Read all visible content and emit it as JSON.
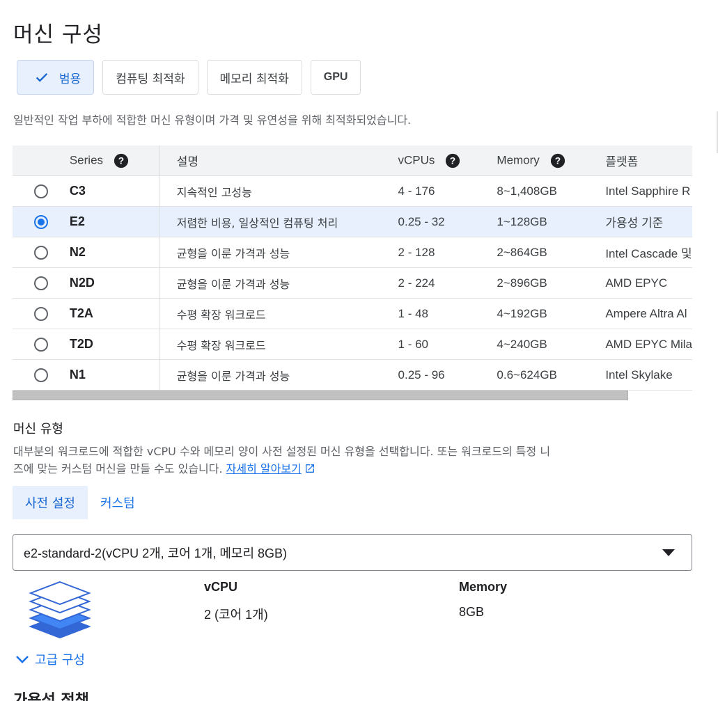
{
  "title": "머신 구성",
  "family_chips": [
    {
      "label": "범용",
      "selected": true
    },
    {
      "label": "컴퓨팅 최적화",
      "selected": false
    },
    {
      "label": "메모리 최적화",
      "selected": false
    },
    {
      "label": "GPU",
      "selected": false
    }
  ],
  "family_description": "일반적인 작업 부하에 적합한 머신 유형이며 가격 및 유연성을 위해 최적화되었습니다.",
  "series_table": {
    "headers": {
      "series": "Series",
      "description": "설명",
      "vcpus": "vCPUs",
      "memory": "Memory",
      "platform": "플랫폼"
    },
    "rows": [
      {
        "series": "C3",
        "description": "지속적인 고성능",
        "vcpus": "4 - 176",
        "memory": "8~1,408GB",
        "platform": "Intel Sapphire R",
        "selected": false
      },
      {
        "series": "E2",
        "description": "저렴한 비용, 일상적인 컴퓨팅 처리",
        "vcpus": "0.25 - 32",
        "memory": "1~128GB",
        "platform": "가용성 기준",
        "selected": true
      },
      {
        "series": "N2",
        "description": "균형을 이룬 가격과 성능",
        "vcpus": "2 - 128",
        "memory": "2~864GB",
        "platform": "Intel Cascade 및",
        "selected": false
      },
      {
        "series": "N2D",
        "description": "균형을 이룬 가격과 성능",
        "vcpus": "2 - 224",
        "memory": "2~896GB",
        "platform": "AMD EPYC",
        "selected": false
      },
      {
        "series": "T2A",
        "description": "수평 확장 워크로드",
        "vcpus": "1 - 48",
        "memory": "4~192GB",
        "platform": "Ampere Altra Al",
        "selected": false
      },
      {
        "series": "T2D",
        "description": "수평 확장 워크로드",
        "vcpus": "1 - 60",
        "memory": "4~240GB",
        "platform": "AMD EPYC Mila",
        "selected": false
      },
      {
        "series": "N1",
        "description": "균형을 이룬 가격과 성능",
        "vcpus": "0.25 - 96",
        "memory": "0.6~624GB",
        "platform": "Intel Skylake",
        "selected": false
      }
    ]
  },
  "machine_type": {
    "title": "머신 유형",
    "description": "대부분의 워크로드에 적합한 vCPU 수와 메모리 양이 사전 설정된 머신 유형을 선택합니다. 또는 워크로드의 특정 니즈에 맞는 커스텀 머신을 만들 수도 있습니다.",
    "learn_more": "자세히 알아보기",
    "tabs": [
      {
        "label": "사전 설정",
        "active": true
      },
      {
        "label": "커스텀",
        "active": false
      }
    ],
    "selected_value": "e2-standard-2(vCPU 2개, 코어 1개, 메모리 8GB)",
    "vcpu_label": "vCPU",
    "vcpu_value": "2 (코어 1개)",
    "memory_label": "Memory",
    "memory_value": "8GB"
  },
  "advanced_config": "고급 구성",
  "next_section_title": "가용성 정책",
  "colors": {
    "accent": "#1a73e8",
    "selected_bg": "#e8f0fe",
    "header_bg": "#f1f3f4"
  }
}
